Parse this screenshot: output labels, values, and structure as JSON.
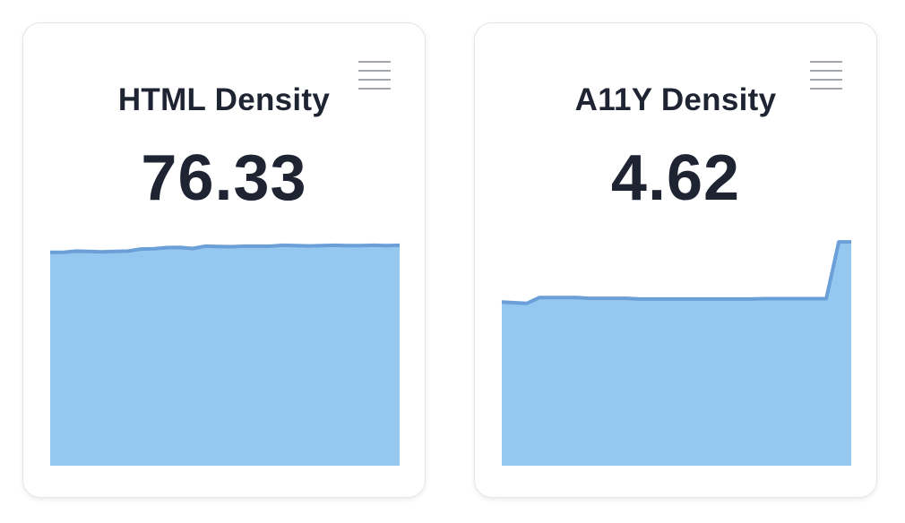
{
  "cards": [
    {
      "title": "HTML Density",
      "value": "76.33",
      "menu_icon": "hamburger-menu-icon"
    },
    {
      "title": "A11Y Density",
      "value": "4.62",
      "menu_icon": "hamburger-menu-icon"
    }
  ],
  "colors": {
    "area_fill": "#95c8f0",
    "area_line": "#6b9fd8",
    "text": "#1f2433",
    "menu_icon": "#a2a6ad"
  },
  "chart_data": [
    {
      "type": "area",
      "title": "HTML Density",
      "xlabel": "",
      "ylabel": "",
      "grid": false,
      "ylim": [
        0,
        80
      ],
      "series": [
        {
          "values": [
            73.9,
            73.9,
            74.3,
            74.2,
            74.0,
            74.2,
            74.3,
            75.0,
            75.1,
            75.5,
            75.6,
            75.2,
            76.0,
            75.9,
            75.8,
            76.0,
            76.0,
            76.0,
            76.3,
            76.2,
            76.1,
            76.2,
            76.3,
            76.2,
            76.2,
            76.3,
            76.2,
            76.3
          ]
        }
      ]
    },
    {
      "type": "area",
      "title": "A11Y Density",
      "xlabel": "",
      "ylabel": "",
      "grid": false,
      "ylim": [
        0,
        6.35
      ],
      "series": [
        {
          "values": [
            4.5,
            4.48,
            4.46,
            4.62,
            4.62,
            4.62,
            4.62,
            4.6,
            4.6,
            4.6,
            4.6,
            4.58,
            4.58,
            4.58,
            4.58,
            4.58,
            4.58,
            4.58,
            4.58,
            4.58,
            4.58,
            4.59,
            4.59,
            4.59,
            4.59,
            4.59,
            4.59,
            6.15,
            6.15
          ]
        }
      ]
    }
  ]
}
